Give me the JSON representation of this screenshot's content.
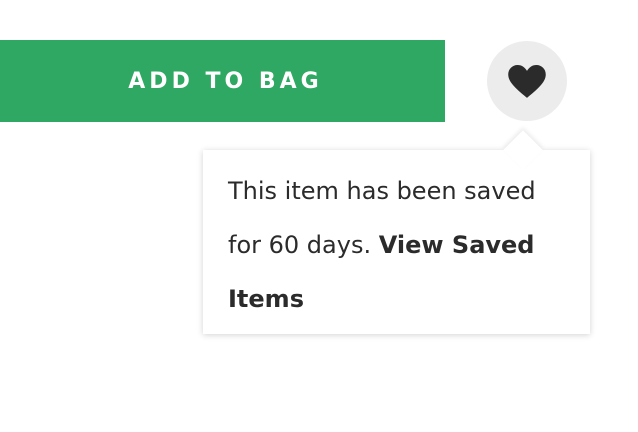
{
  "add_to_bag": {
    "label": "ADD TO BAG",
    "color": "#2ea862"
  },
  "save_button": {
    "icon": "heart-icon",
    "background": "#ececec"
  },
  "tooltip": {
    "message": "This item has been saved for 60 days.",
    "link_label": "View Saved Items"
  }
}
